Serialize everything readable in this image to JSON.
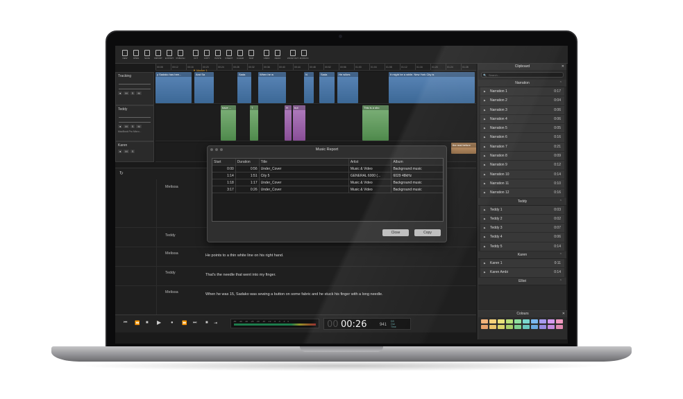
{
  "device": {
    "brand": "MacBook Pro"
  },
  "toolbar": {
    "buttons": [
      {
        "label": "NEW",
        "icon": "new-file-icon"
      },
      {
        "label": "OPEN",
        "icon": "open-file-icon"
      },
      {
        "label": "SAVE",
        "icon": "save-icon"
      },
      {
        "label": "IMPORT",
        "icon": "import-icon"
      },
      {
        "label": "EXPORT",
        "icon": "export-icon"
      },
      {
        "label": "PUBLISH",
        "icon": "publish-icon"
      },
      {
        "label": "CUT",
        "icon": "scissors-icon"
      },
      {
        "label": "COPY",
        "icon": "copy-icon"
      },
      {
        "label": "PASTE",
        "icon": "paste-icon"
      },
      {
        "label": "INSERT",
        "icon": "insert-icon"
      },
      {
        "label": "CLEAR",
        "icon": "clear-icon"
      },
      {
        "label": "SKIP",
        "icon": "skip-icon"
      },
      {
        "label": "UNDO",
        "icon": "undo-icon"
      },
      {
        "label": "REDO",
        "icon": "redo-icon"
      },
      {
        "label": "ZOOM OUT",
        "icon": "zoom-out-icon"
      },
      {
        "label": "ZOOM IN",
        "icon": "zoom-in-icon"
      }
    ]
  },
  "ruler": {
    "ticks": [
      "00:08",
      "00:12",
      "00:16",
      "00:20",
      "00:24",
      "00:28",
      "00:32",
      "00:36",
      "00:40",
      "00:44",
      "00:48",
      "00:52",
      "00:56",
      "01:00",
      "01:04",
      "01:08",
      "01:12",
      "01:16",
      "01:20",
      "01:24",
      "01:28"
    ],
    "marker": "Marker 1"
  },
  "tracks": [
    {
      "name": "Tracking",
      "clips": [
        {
          "text": "y Sadako has bee..."
        },
        {
          "text": "And Sa"
        },
        {
          "text": "Sada"
        },
        {
          "text": "When he w"
        },
        {
          "text": "N"
        },
        {
          "text": "Sada"
        },
        {
          "text": "He w/kes"
        },
        {
          "text": "It might be a while. New York City is"
        }
      ]
    },
    {
      "name": "Teddy",
      "device": "MacBook Pro Micro...",
      "clips": [
        {
          "text": "have ..."
        },
        {
          "text": "T"
        },
        {
          "text": "H"
        },
        {
          "text": "but"
        },
        {
          "text": "This is a sho"
        }
      ]
    },
    {
      "name": "Karen",
      "clips": [
        {
          "text": "the real before"
        }
      ]
    }
  ],
  "transcript": [
    {
      "speaker": "Melissa",
      "text": ""
    },
    {
      "speaker": "Teddy",
      "text": ""
    },
    {
      "speaker": "Melissa",
      "text": "He points to a thin white line on his right hand."
    },
    {
      "speaker": "Teddy",
      "text": "That's the needle that went into my finger."
    },
    {
      "speaker": "Melissa",
      "text": "When he was 15, Sadako was sewing a button on some fabric and he stuck his finger with a long needle."
    }
  ],
  "transport": {
    "meter_labels": [
      "-60",
      "-40",
      "-30",
      "-25",
      "-20",
      "-15",
      "-12",
      "-9",
      "-6",
      "-3",
      "0"
    ],
    "time": "00:26",
    "time_ghost": "00",
    "frames": "941",
    "side": [
      "DS",
      "Out",
      "Time"
    ]
  },
  "clipboard": {
    "title": "Clipboard",
    "search_placeholder": "Search...",
    "groups": [
      {
        "name": "Narration",
        "items": [
          {
            "label": "Narration  1",
            "dur": "0:17"
          },
          {
            "label": "Narration  2",
            "dur": "0:04"
          },
          {
            "label": "Narration  3",
            "dur": "0:06"
          },
          {
            "label": "Narration  4",
            "dur": "0:06"
          },
          {
            "label": "Narration  5",
            "dur": "0:05"
          },
          {
            "label": "Narration  6",
            "dur": "0:16"
          },
          {
            "label": "Narration  7",
            "dur": "0:21"
          },
          {
            "label": "Narration  8",
            "dur": "0:09"
          },
          {
            "label": "Narration  9",
            "dur": "0:12"
          },
          {
            "label": "Narration  10",
            "dur": "0:14"
          },
          {
            "label": "Narration  11",
            "dur": "0:10"
          },
          {
            "label": "Narration  12",
            "dur": "0:16"
          }
        ]
      },
      {
        "name": "Teddy",
        "items": [
          {
            "label": "Teddy 1",
            "dur": "0:03"
          },
          {
            "label": "Teddy 2",
            "dur": "0:02"
          },
          {
            "label": "Teddy 3",
            "dur": "0:07"
          },
          {
            "label": "Teddy 4",
            "dur": "0:06"
          },
          {
            "label": "Teddy 5",
            "dur": "0:14"
          }
        ]
      },
      {
        "name": "Karen",
        "items": [
          {
            "label": "Karen 1",
            "dur": "0:11"
          },
          {
            "label": "Karen Ambi",
            "dur": "0:14"
          }
        ]
      },
      {
        "name": "Elliot",
        "items": []
      }
    ],
    "colours_title": "Colours",
    "swatches": [
      "#f2b27a",
      "#f5d27a",
      "#e8e27a",
      "#b8e07a",
      "#8fe0a0",
      "#7ad8d0",
      "#7ab8f0",
      "#a89af0",
      "#d49af0",
      "#f09ac0",
      "#e7a06a",
      "#e9c36a",
      "#d8d46a",
      "#a8d06a",
      "#7fd090",
      "#6ac8c0",
      "#6aa8e0",
      "#988ae0",
      "#c48ae0",
      "#e08ab0"
    ]
  },
  "dialog": {
    "title": "Music Report",
    "columns": [
      "Start",
      "Duration",
      "Title",
      "Artist",
      "Album"
    ],
    "rows": [
      [
        "0:00",
        "0:56",
        "Under_Cover",
        "Music & Video",
        "Background music"
      ],
      [
        "1:14",
        "1:51",
        "City 5",
        "GENERAL 6000 (...",
        "6029 48kHz"
      ],
      [
        "1:18",
        "1:17",
        "Under_Cover",
        "Music & Video",
        "Background music"
      ],
      [
        "3:17",
        "0:26",
        "Under_Cover",
        "Music & Video",
        "Background music"
      ]
    ],
    "close_label": "Close",
    "copy_label": "Copy"
  }
}
